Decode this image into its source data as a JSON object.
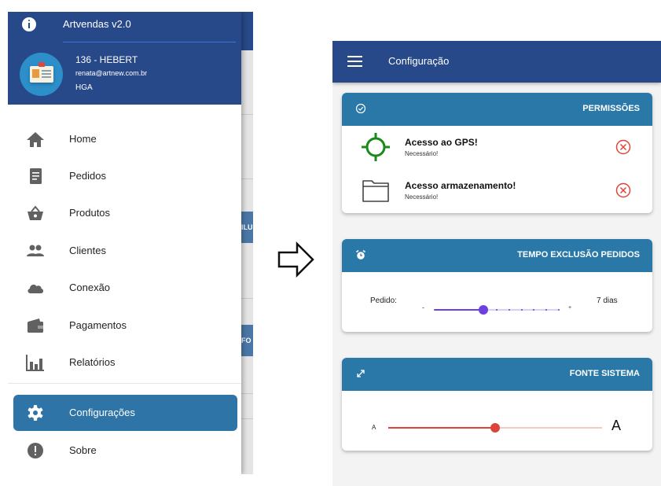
{
  "drawer": {
    "app_version": "Artvendas v2.0",
    "user": {
      "name": "136 - HEBERT",
      "email": "renata@artnew.com.br",
      "company": "HGA"
    },
    "menu": [
      {
        "label": "Home",
        "icon": "home-icon",
        "active": false
      },
      {
        "label": "Pedidos",
        "icon": "document-icon",
        "active": false
      },
      {
        "label": "Produtos",
        "icon": "basket-icon",
        "active": false
      },
      {
        "label": "Clientes",
        "icon": "people-icon",
        "active": false
      },
      {
        "label": "Conexão",
        "icon": "cloud-icon",
        "active": false
      },
      {
        "label": "Pagamentos",
        "icon": "wallet-icon",
        "active": false
      },
      {
        "label": "Relatórios",
        "icon": "bar-chart-icon",
        "active": false
      },
      {
        "label": "Configurações",
        "icon": "gear-icon",
        "active": true
      },
      {
        "label": "Sobre",
        "icon": "exclamation-icon",
        "active": false
      }
    ],
    "background_fragments": [
      "ILU",
      "FO"
    ]
  },
  "config": {
    "title": "Configuração",
    "permissions": {
      "title": "PERMISSÕES",
      "icon": "check-circle-icon",
      "items": [
        {
          "title": "Acesso ao GPS!",
          "subtitle": "Necessário!",
          "icon": "gps-crosshair-icon",
          "status_icon": "denied-x-icon"
        },
        {
          "title": "Acesso armazenamento!",
          "subtitle": "Necessário!",
          "icon": "folder-icon",
          "status_icon": "denied-x-icon"
        }
      ]
    },
    "order_deletion": {
      "title": "TEMPO EXCLUSÃO PEDIDOS",
      "icon": "alarm-icon",
      "label": "Pedido:",
      "minus": "-",
      "plus": "+",
      "value_text": "7 dias",
      "slider_fraction": 0.39,
      "slider_steps": 10
    },
    "system_font": {
      "title": "FONTE SISTEMA",
      "icon": "expand-icon",
      "min_label": "A",
      "max_label": "A",
      "slider_fraction": 0.5
    }
  },
  "colors": {
    "header_blue": "#27498a",
    "card_header_blue": "#2a78a8",
    "active_item": "#2e74a6",
    "gps_green": "#1a8a1a",
    "denied_red": "#e0453a",
    "slider_purple": "#6b3fe0",
    "slider_red": "#d9453a"
  }
}
